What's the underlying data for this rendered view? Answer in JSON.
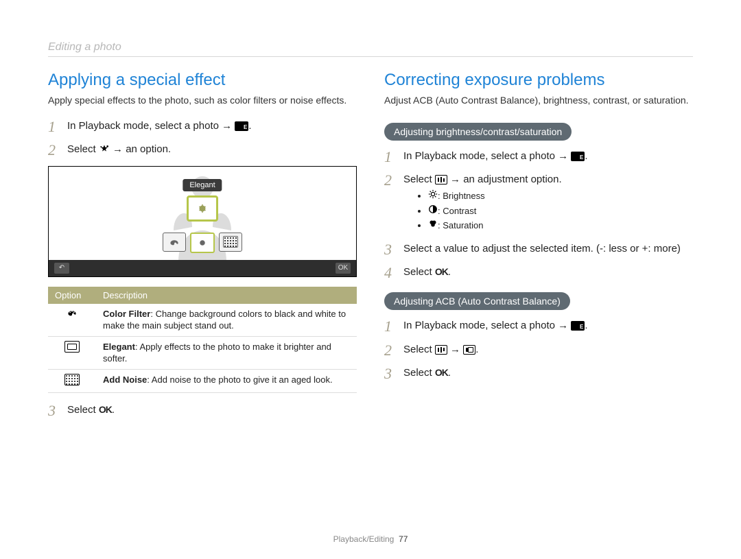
{
  "breadcrumb": "Editing a photo",
  "left": {
    "title": "Applying a special effect",
    "intro": "Apply special effects to the photo, such as color filters or noise effects.",
    "steps": {
      "s1_pre": "In Playback mode, select a photo → ",
      "s1_post": ".",
      "s2_pre": "Select ",
      "s2_post": " → an option.",
      "s3_pre": "Select ",
      "s3_post": "."
    },
    "preview_label": "Elegant",
    "preview_ok": "OK",
    "table": {
      "h_option": "Option",
      "h_desc": "Description",
      "r1_label": "Color Filter",
      "r1_desc": ": Change background colors to black and white to make the main subject stand out.",
      "r2_label": "Elegant",
      "r2_desc": ": Apply effects to the photo to make it brighter and softer.",
      "r3_label": "Add Noise",
      "r3_desc": ": Add noise to the photo to give it an aged look."
    }
  },
  "right": {
    "title": "Correcting exposure problems",
    "intro": "Adjust ACB (Auto Contrast Balance), brightness, contrast, or saturation.",
    "pill1": "Adjusting brightness/contrast/saturation",
    "steps1": {
      "s1_pre": "In Playback mode, select a photo → ",
      "s1_post": ".",
      "s2_pre": "Select ",
      "s2_post": " → an adjustment option.",
      "b1": ": Brightness",
      "b2": ": Contrast",
      "b3": ": Saturation",
      "s3": "Select a value to adjust the selected item. (-: less or +: more)",
      "s4_pre": "Select ",
      "s4_post": "."
    },
    "pill2": "Adjusting ACB (Auto Contrast Balance)",
    "steps2": {
      "s1_pre": "In Playback mode, select a photo → ",
      "s1_post": ".",
      "s2_pre": "Select ",
      "s2_mid": " → ",
      "s2_post": ".",
      "s3_pre": "Select ",
      "s3_post": "."
    }
  },
  "footer": {
    "section": "Playback/Editing",
    "page": "77"
  },
  "ok_label": "OK"
}
